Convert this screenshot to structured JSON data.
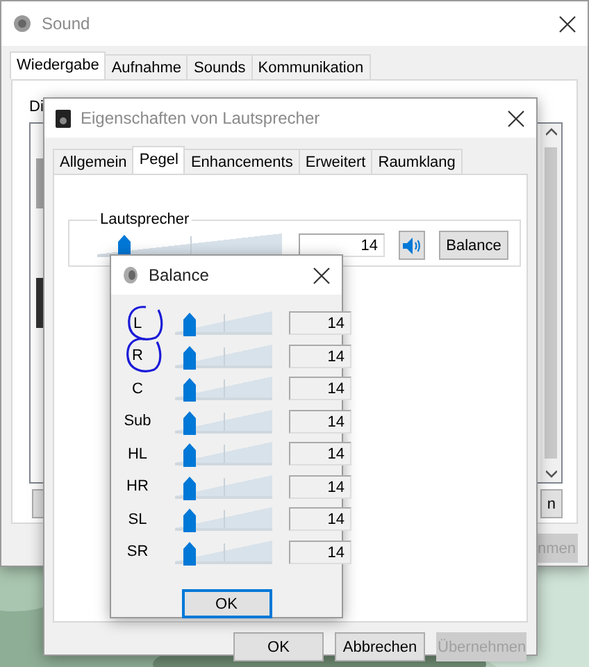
{
  "sound_window": {
    "title": "Sound",
    "tabs": [
      {
        "label": "Wiedergabe",
        "selected": true
      },
      {
        "label": "Aufnahme",
        "selected": false
      },
      {
        "label": "Sounds",
        "selected": false
      },
      {
        "label": "Kommunikation",
        "selected": false
      }
    ],
    "intro_text": "Di",
    "list_button": "n",
    "apply_button": {
      "label": "nmen",
      "disabled": true
    }
  },
  "properties_dialog": {
    "title": "Eigenschaften von Lautsprecher",
    "tabs": [
      {
        "label": "Allgemein",
        "selected": false
      },
      {
        "label": "Pegel",
        "selected": true
      },
      {
        "label": "Enhancements",
        "selected": false
      },
      {
        "label": "Erweitert",
        "selected": false
      },
      {
        "label": "Raumklang",
        "selected": false
      }
    ],
    "group": {
      "title": "Lautsprecher",
      "level": 0.14,
      "value": "14",
      "muted": false,
      "balance_button": "Balance"
    },
    "buttons": [
      {
        "label": "OK",
        "disabled": false
      },
      {
        "label": "Abbrechen",
        "disabled": false
      },
      {
        "label": "Übernehmen",
        "disabled": true
      }
    ]
  },
  "balance_dialog": {
    "title": "Balance",
    "channels": [
      {
        "name": "L",
        "level": 0.14,
        "value": "14",
        "circled": true
      },
      {
        "name": "R",
        "level": 0.14,
        "value": "14",
        "circled": true
      },
      {
        "name": "C",
        "level": 0.14,
        "value": "14",
        "circled": false
      },
      {
        "name": "Sub",
        "level": 0.14,
        "value": "14",
        "circled": false
      },
      {
        "name": "HL",
        "level": 0.14,
        "value": "14",
        "circled": false
      },
      {
        "name": "HR",
        "level": 0.14,
        "value": "14",
        "circled": false
      },
      {
        "name": "SL",
        "level": 0.14,
        "value": "14",
        "circled": false
      },
      {
        "name": "SR",
        "level": 0.14,
        "value": "14",
        "circled": false
      }
    ],
    "ok_button": "OK"
  }
}
